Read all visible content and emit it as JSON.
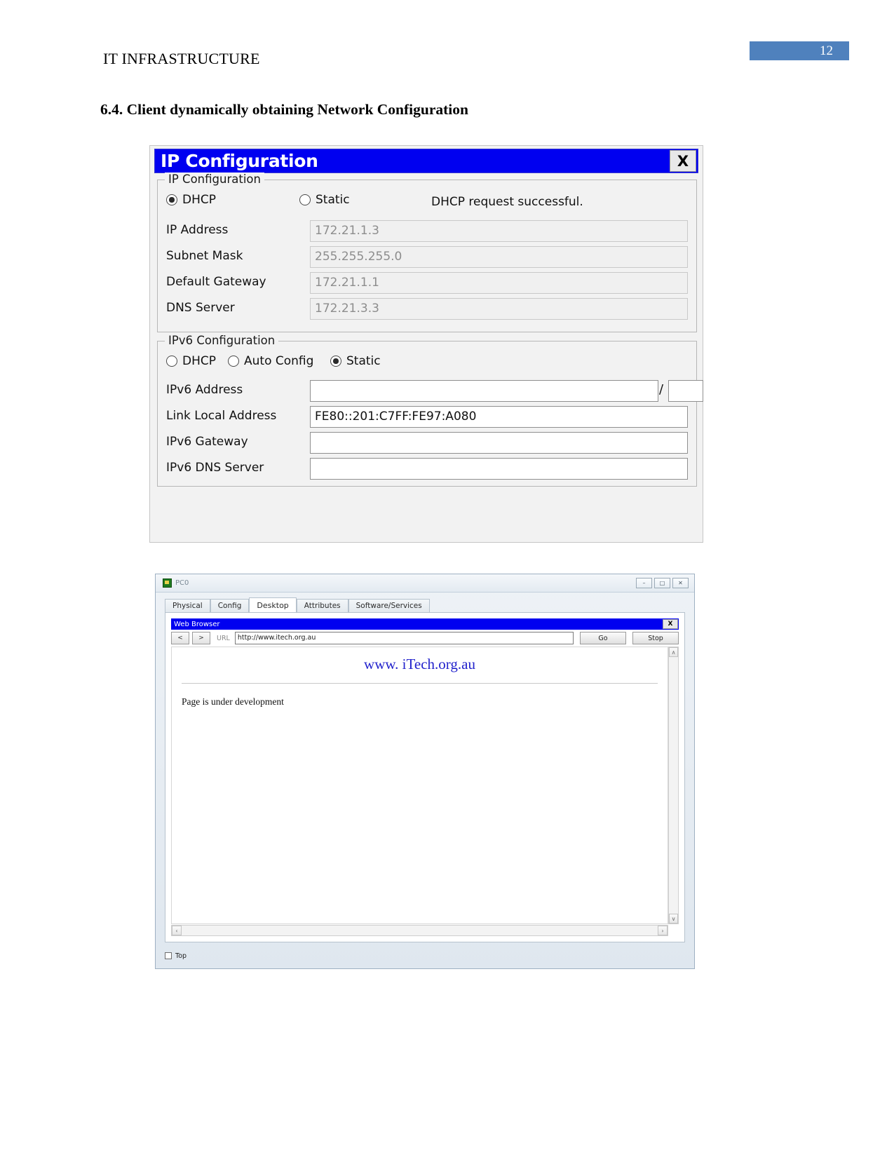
{
  "document": {
    "header_title": "IT INFRASTRUCTURE",
    "page_number": "12",
    "section_heading": "6.4. Client dynamically obtaining Network Configuration",
    "accent_color": "#4f81bd"
  },
  "ip_config_dialog": {
    "title": "IP Configuration",
    "close_label": "X",
    "ipv4": {
      "legend": "IP Configuration",
      "mode_options": [
        {
          "label": "DHCP",
          "selected": true
        },
        {
          "label": "Static",
          "selected": false
        }
      ],
      "status_message": "DHCP request successful.",
      "fields": [
        {
          "label": "IP Address",
          "value": "172.21.1.3"
        },
        {
          "label": "Subnet Mask",
          "value": "255.255.255.0"
        },
        {
          "label": "Default Gateway",
          "value": "172.21.1.1"
        },
        {
          "label": "DNS Server",
          "value": "172.21.3.3"
        }
      ]
    },
    "ipv6": {
      "legend": "IPv6 Configuration",
      "mode_options": [
        {
          "label": "DHCP",
          "selected": false
        },
        {
          "label": "Auto Config",
          "selected": false
        },
        {
          "label": "Static",
          "selected": true
        }
      ],
      "address_label": "IPv6 Address",
      "address_value": "",
      "prefix_separator": "/",
      "prefix_value": "",
      "fields": [
        {
          "label": "Link Local Address",
          "value": "FE80::201:C7FF:FE97:A080"
        },
        {
          "label": "IPv6 Gateway",
          "value": ""
        },
        {
          "label": "IPv6 DNS Server",
          "value": ""
        }
      ]
    }
  },
  "pc_window": {
    "title": "PC0",
    "window_buttons": {
      "minimize": "–",
      "maximize": "□",
      "close": "✕"
    },
    "tabs": [
      {
        "label": "Physical",
        "active": false
      },
      {
        "label": "Config",
        "active": false
      },
      {
        "label": "Desktop",
        "active": true
      },
      {
        "label": "Attributes",
        "active": false
      },
      {
        "label": "Software/Services",
        "active": false
      }
    ],
    "browser": {
      "title": "Web Browser",
      "close_label": "X",
      "back_label": "<",
      "forward_label": ">",
      "url_label": "URL",
      "url_value": "http://www.itech.org.au",
      "go_label": "Go",
      "stop_label": "Stop",
      "scroll_up": "∧",
      "scroll_down": "∨",
      "scroll_left": "‹",
      "scroll_right": "›",
      "page": {
        "site_title": "www. iTech.org.au",
        "body_text": "Page is under development"
      }
    },
    "footer": {
      "top_checkbox_label": "Top",
      "top_checkbox_checked": false
    }
  }
}
